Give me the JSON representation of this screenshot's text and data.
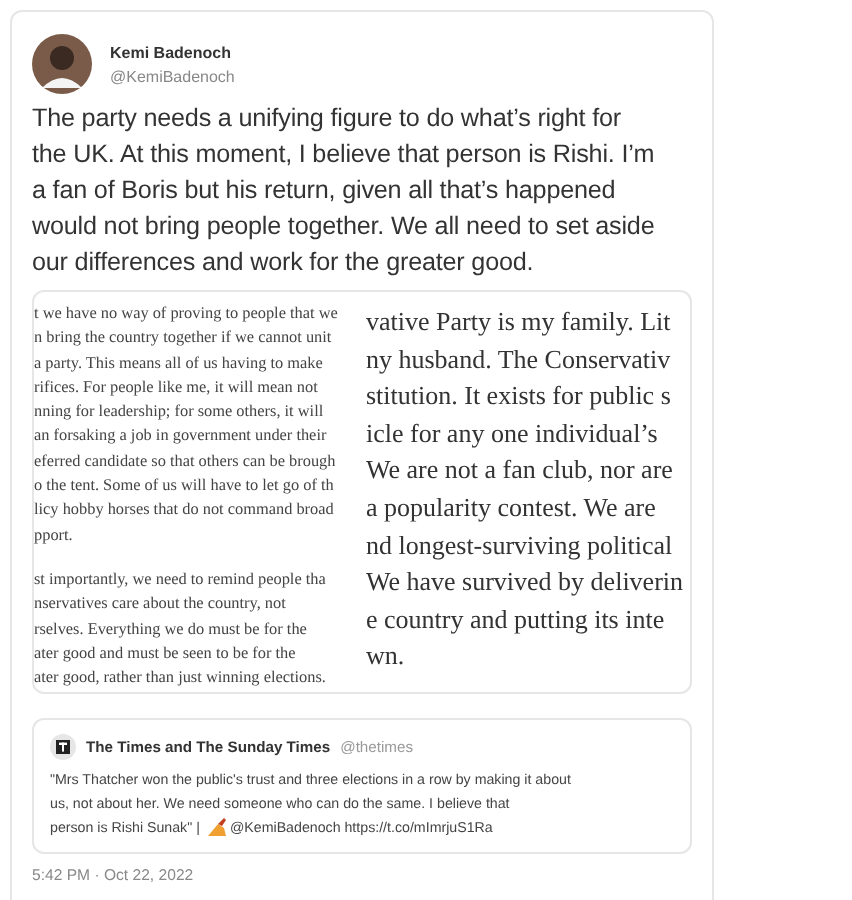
{
  "author": {
    "name": "Kemi Badenoch",
    "handle": "@KemiBadenoch"
  },
  "text": "The party needs a unifying figure to do what’s right for the UK. At this moment, I believe that person is Rishi.  I’m a fan of Boris but his return, given all that’s happened would not bring people together. We all need to set aside our differences and work for the greater good.",
  "image": {
    "left_lines": [
      "t we have no way of proving to people that we",
      "n bring the country together if we cannot unit",
      "a party. This means all of us having to make",
      "rifices. For people like me, it will mean not",
      "nning for leadership; for some others, it will",
      "an forsaking a job in government under their",
      "eferred candidate so that others can be brough",
      "o the tent. Some of us will have to let go of th",
      "licy hobby horses that do not command broad",
      "pport.",
      "st importantly, we need to remind people tha",
      "nservatives care about the country, not",
      "rselves. Everything we do must be for the",
      "ater good and must be seen to be for the",
      "ater good, rather than just winning elections."
    ],
    "right_lines": [
      "vative Party is my family. Lit",
      "ny husband. The Conservativ",
      "stitution. It exists for public s",
      "icle for any one individual’s",
      "We are not a fan club, nor are",
      "a popularity contest. We are",
      "nd longest-surviving political",
      "We have survived by deliverin",
      "e country and putting its inte",
      "wn."
    ]
  },
  "quoted": {
    "name": "The Times and The Sunday Times",
    "handle": "@thetimes",
    "text": "\"Mrs Thatcher won the public's trust and three elections in a row by making it about us, not about her. We need someone who can do the same. I believe that",
    "text_end": "person is Rishi Sunak\" |",
    "mention": "@KemiBadenoch https://t.co/mImrjuS1Ra"
  },
  "timestamp": "5:42 PM · Oct 22, 2022"
}
